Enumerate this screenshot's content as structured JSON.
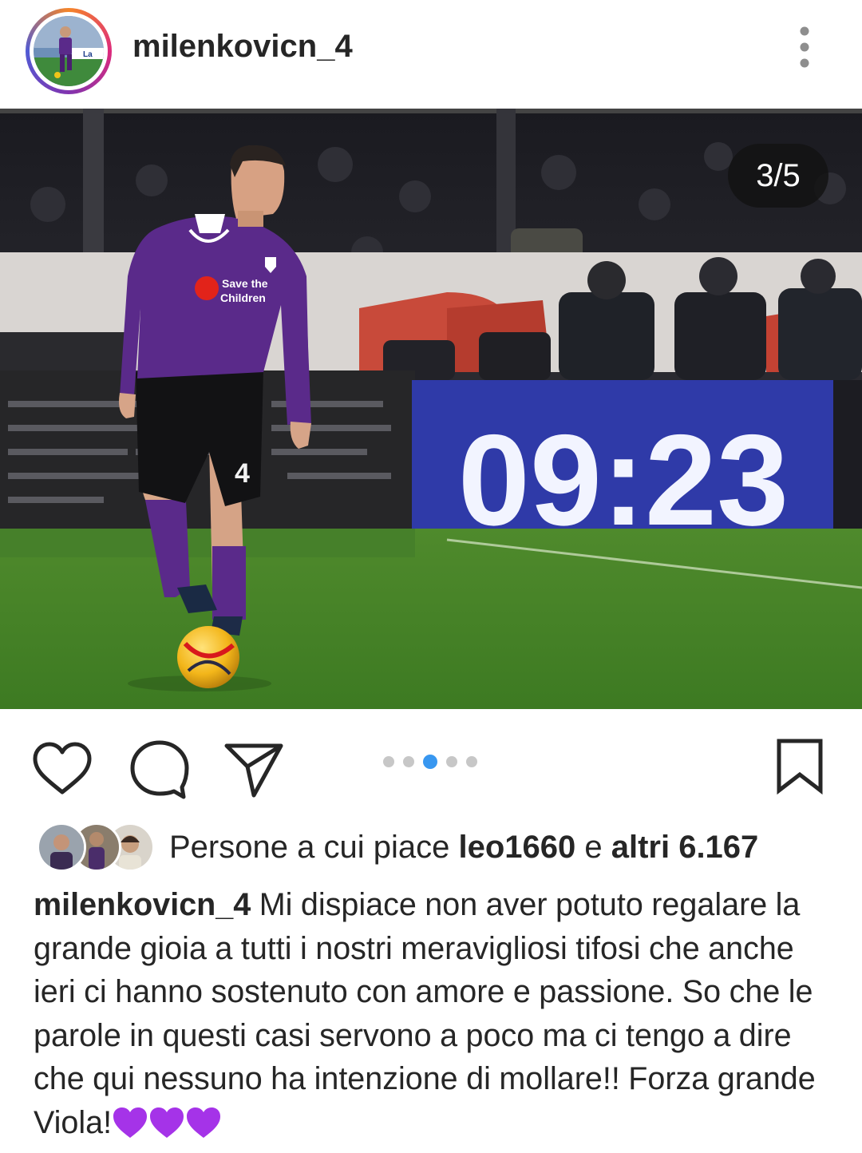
{
  "post": {
    "username": "milenkovicn_4",
    "more_icon": "more-vertical-icon",
    "media_counter": "3/5",
    "carousel": {
      "total": 5,
      "active_index": 2
    },
    "photo": {
      "description_icon": "match-photo",
      "scoreboard_time": "09:23",
      "shirt_sponsor_line1": "Save the",
      "shirt_sponsor_line2": "Children",
      "shirt_number": "4"
    },
    "actions": {
      "like_icon": "heart-icon",
      "comment_icon": "comment-icon",
      "share_icon": "send-icon",
      "save_icon": "bookmark-icon"
    },
    "likes": {
      "prefix": "Persone a cui piace ",
      "user": "leo1660",
      "middle": " e ",
      "others": "altri 6.167"
    },
    "caption": {
      "user": "milenkovicn_4",
      "text": " Mi dispiace non aver potuto regalare la grande gioia a tutti i nostri meravigliosi tifosi che anche ieri ci hanno sostenuto con amore e passione. So che le parole in questi casi servono a poco ma ci tengo a dire che qui nessuno ha intenzione di mollare!! Forza grande Viola!",
      "emoji": "purple-heart-icon"
    },
    "colors": {
      "purple": "#5a2a8a",
      "accent_blue": "#3897f0",
      "board_blue": "#2f3aa8",
      "heart_purple": "#a533e8"
    }
  }
}
